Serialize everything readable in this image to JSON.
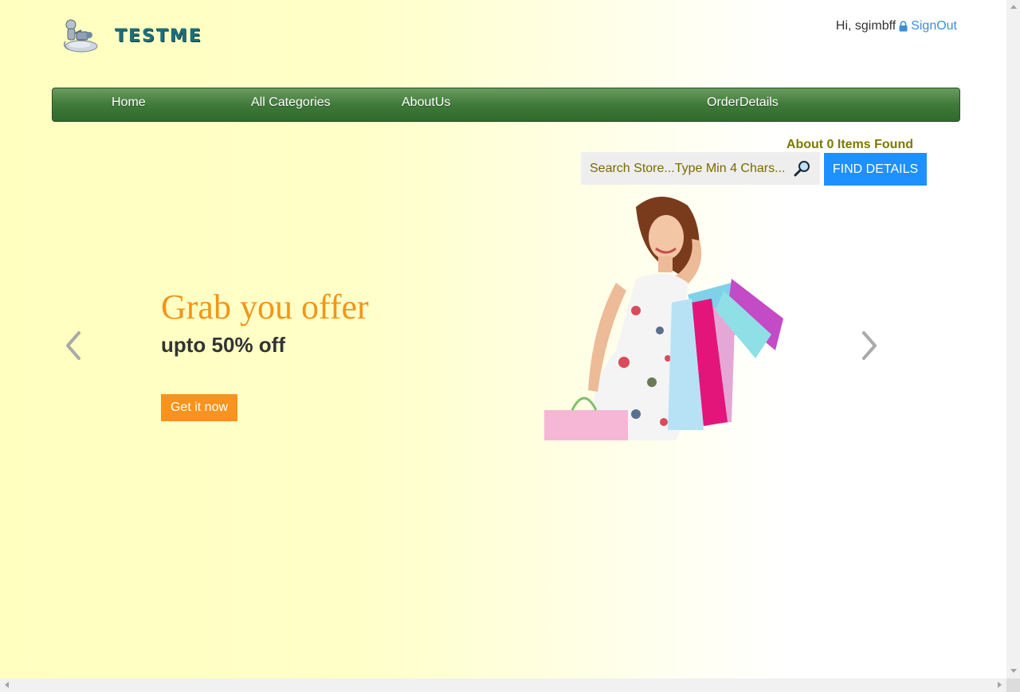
{
  "header": {
    "brand": "TESTME",
    "greeting": "Hi, sgimbff",
    "signout_label": "SignOut"
  },
  "nav": {
    "items": [
      {
        "label": "Home"
      },
      {
        "label": "All Categories"
      },
      {
        "label": "AboutUs"
      },
      {
        "label": "OrderDetails"
      }
    ]
  },
  "search": {
    "result_text": "About 0 Items Found",
    "placeholder": "Search Store...Type Min 4 Chars...",
    "value": "",
    "button_label": "FIND DETAILS"
  },
  "carousel": {
    "headline": "Grab you offer",
    "subheadline": "upto 50% off",
    "cta_label": "Get it now"
  },
  "colors": {
    "accent_orange": "#f39519",
    "nav_green": "#3f7a3a",
    "find_button": "#1e90ff",
    "link_blue": "#3a8fd8",
    "found_text": "#7a7a00"
  },
  "icons": [
    "logo-mascot-icon",
    "lock-icon",
    "search-icon",
    "chevron-left-icon",
    "chevron-right-icon"
  ]
}
